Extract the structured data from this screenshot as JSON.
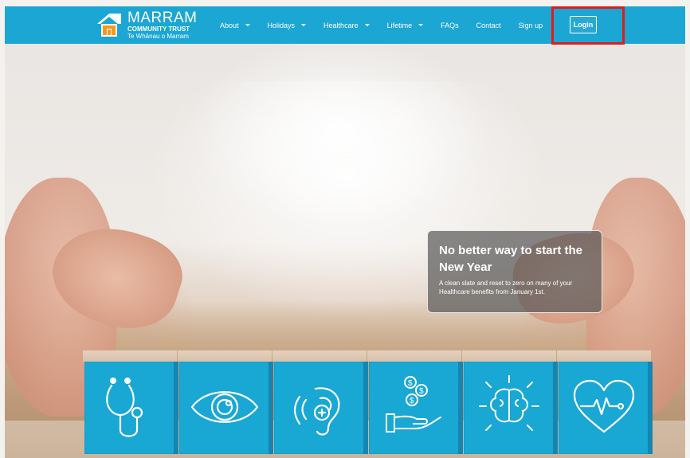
{
  "brand": {
    "name": "MARRAM",
    "subtitle": "COMMUNITY TRUST",
    "tagline": "Te Whānau o Marram"
  },
  "nav": {
    "items": [
      {
        "label": "About",
        "has_dropdown": true
      },
      {
        "label": "Holidays",
        "has_dropdown": true
      },
      {
        "label": "Healthcare",
        "has_dropdown": true
      },
      {
        "label": "Lifetime",
        "has_dropdown": true
      },
      {
        "label": "FAQs",
        "has_dropdown": false
      },
      {
        "label": "Contact",
        "has_dropdown": false
      },
      {
        "label": "Sign up",
        "has_dropdown": false
      }
    ],
    "login_label": "Login"
  },
  "promo": {
    "heading": "No better way to start the New Year",
    "body": "A clean slate and reset to zero on many of your Healthcare benefits from January 1st."
  },
  "cubes": {
    "icons": [
      "stethoscope-icon",
      "eye-icon",
      "ear-icon",
      "money-hand-icon",
      "brain-icon",
      "heart-pulse-icon"
    ]
  },
  "colors": {
    "brand_blue": "#1ba6d3",
    "highlight_red": "#e21b1b",
    "logo_orange": "#f39a1e"
  }
}
